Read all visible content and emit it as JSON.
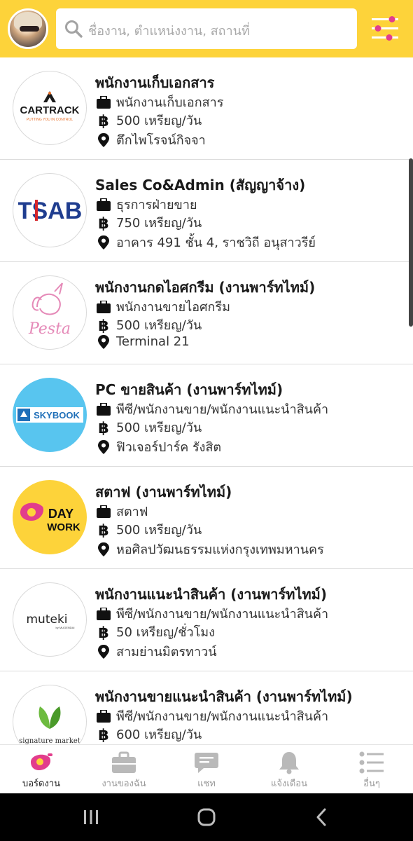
{
  "search": {
    "placeholder": "ชื่องาน, ตำแหน่งงาน, สถานที่"
  },
  "jobs": [
    {
      "title": "พนักงานเก็บเอกสาร",
      "position": "พนักงานเก็บเอกสาร",
      "wage": "500 เหรียญ/วัน",
      "location": "ตึกไพโรจน์กิจจา",
      "logo_text": "CARTRACK",
      "logo_sub": "PUTTING YOU IN CONTROL"
    },
    {
      "title": "Sales Co&Admin (สัญญาจ้าง)",
      "position": "ธุรการฝ่ายขาย",
      "wage": "750 เหรียญ/วัน",
      "location": "อาคาร 491 ชั้น 4, ราชวิถี อนุสาวรีย์",
      "logo_text": "TSAB"
    },
    {
      "title": "พนักงานกดไอศกรีม (งานพาร์ทไทม์)",
      "position": "พนักงานขายไอศกรีม",
      "wage": "500 เหรียญ/วัน",
      "location": "Terminal 21",
      "logo_text": "Pesta"
    },
    {
      "title": "PC ขายสินค้า (งานพาร์ทไทม์)",
      "position": "พีซี/พนักงานขาย/พนักงานแนะนำสินค้า",
      "wage": "500 เหรียญ/วัน",
      "location": "ฟิวเจอร์ปาร์ค รังสิต",
      "logo_text": "SKYBOOK"
    },
    {
      "title": "สตาฟ (งานพาร์ทไทม์)",
      "position": "สตาฟ",
      "wage": "500 เหรียญ/วัน",
      "location": "หอศิลปวัฒนธรรมแห่งกรุงเทพมหานคร",
      "logo_text": "DAY",
      "logo_text2": "WORK"
    },
    {
      "title": "พนักงานแนะนำสินค้า (งานพาร์ทไทม์)",
      "position": "พีซี/พนักงานขาย/พนักงานแนะนำสินค้า",
      "wage": "50 เหรียญ/ชั่วโมง",
      "location": "สามย่านมิตรทาวน์",
      "logo_text": "muteki",
      "logo_sub": "by MUGENDAI"
    },
    {
      "title": "พนักงานขายแนะนำสินค้า (งานพาร์ทไทม์)",
      "position": "พีซี/พนักงานขาย/พนักงานแนะนำสินค้า",
      "wage": "600 เหรียญ/วัน",
      "location": "",
      "logo_text": "signature market"
    }
  ],
  "tabs": [
    {
      "label": "บอร์ดงาน",
      "icon": "job-board-icon",
      "active": true
    },
    {
      "label": "งานของฉัน",
      "icon": "briefcase-icon",
      "active": false
    },
    {
      "label": "แชท",
      "icon": "chat-icon",
      "active": false
    },
    {
      "label": "แจ้งเตือน",
      "icon": "bell-icon",
      "active": false
    },
    {
      "label": "อื่นๆ",
      "icon": "more-list-icon",
      "active": false
    }
  ],
  "colors": {
    "brand": "#fdd33a",
    "accent": "#e23d8c",
    "tab_inactive": "#b9b9b9"
  }
}
